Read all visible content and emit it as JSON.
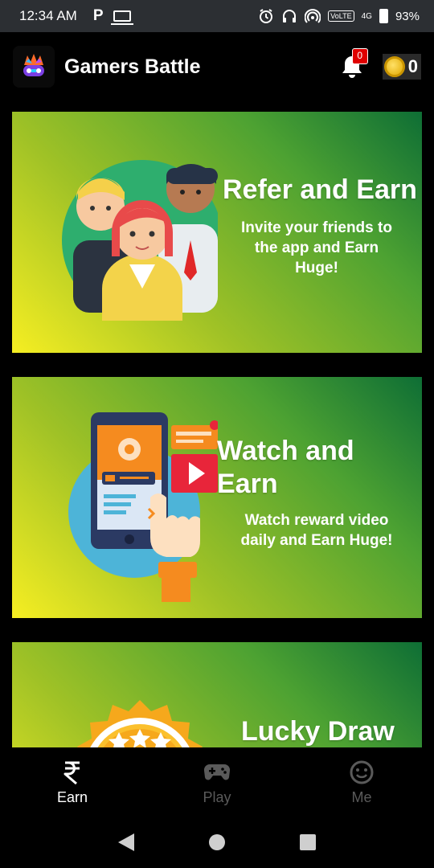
{
  "status_bar": {
    "time": "12:34 AM",
    "parking_label": "P",
    "network": "4G",
    "volte": "VoLTE",
    "battery": "93%"
  },
  "header": {
    "title": "Gamers Battle",
    "notification_count": "0",
    "coin_balance": "0"
  },
  "cards": [
    {
      "title": "Refer and Earn",
      "description": "Invite your friends to the app and Earn Huge!",
      "icon": "refer-people-illustration"
    },
    {
      "title": "Watch and Earn",
      "description": "Watch reward video daily and Earn Huge!",
      "icon": "watch-video-illustration"
    },
    {
      "title": "Lucky Draw",
      "description": "",
      "icon": "lucky-draw-badge-illustration"
    }
  ],
  "bottom_nav": {
    "items": [
      {
        "label": "Earn",
        "icon": "rupee-icon",
        "active": true
      },
      {
        "label": "Play",
        "icon": "gamepad-icon",
        "active": false
      },
      {
        "label": "Me",
        "icon": "smiley-icon",
        "active": false
      }
    ]
  },
  "colors": {
    "card_gradient_start": "#f6ee22",
    "card_gradient_end": "#0e6e35",
    "badge_red": "#e00000",
    "nav_inactive": "#5a5a5a"
  }
}
